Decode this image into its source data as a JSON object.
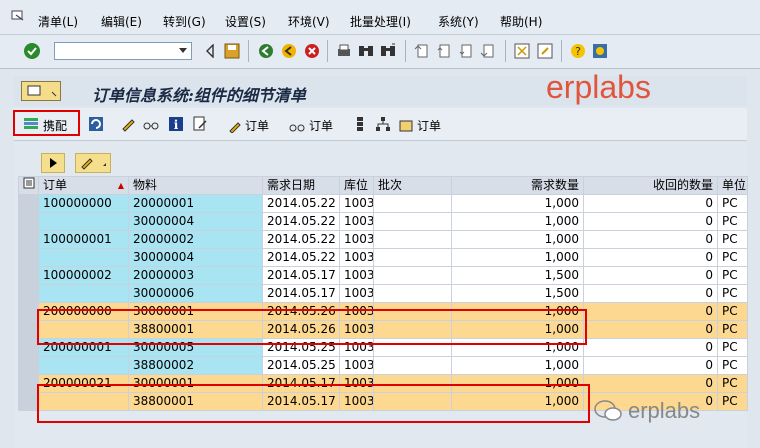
{
  "menu": {
    "items": [
      "清单(L)",
      "编辑(E)",
      "转到(G)",
      "设置(S)",
      "环境(V)",
      "批量处理(I)",
      "系统(Y)",
      "帮助(H)"
    ]
  },
  "command_field": {
    "value": ""
  },
  "title": "订单信息系统:组件的细节清单",
  "watermark": "erplabs",
  "toolbar2": {
    "match_label": "携配",
    "order_label_1": "订单",
    "order_label_2": "订单",
    "order_label_3": "订单"
  },
  "table": {
    "headers": [
      "订单",
      "物料",
      "需求日期",
      "库位",
      "批次",
      "需求数量",
      "收回的数量",
      "单位"
    ],
    "rows": [
      [
        "100000000",
        "20000001",
        "2014.05.22",
        "1003",
        "",
        "1,000",
        "0",
        "PC"
      ],
      [
        "",
        "30000004",
        "2014.05.22",
        "1003",
        "",
        "1,000",
        "0",
        "PC"
      ],
      [
        "100000001",
        "20000002",
        "2014.05.22",
        "1003",
        "",
        "1,000",
        "0",
        "PC"
      ],
      [
        "",
        "30000004",
        "2014.05.22",
        "1003",
        "",
        "1,000",
        "0",
        "PC"
      ],
      [
        "100000002",
        "20000003",
        "2014.05.17",
        "1003",
        "",
        "1,500",
        "0",
        "PC"
      ],
      [
        "",
        "30000006",
        "2014.05.17",
        "1003",
        "",
        "1,500",
        "0",
        "PC"
      ],
      [
        "200000000",
        "30000001",
        "2014.05.26",
        "1003",
        "",
        "1,000",
        "0",
        "PC"
      ],
      [
        "",
        "38800001",
        "2014.05.26",
        "1003",
        "",
        "1,000",
        "0",
        "PC"
      ],
      [
        "200000001",
        "30000005",
        "2014.05.25",
        "1003",
        "",
        "1,000",
        "0",
        "PC"
      ],
      [
        "",
        "38800002",
        "2014.05.25",
        "1003",
        "",
        "1,000",
        "0",
        "PC"
      ],
      [
        "200000021",
        "30000001",
        "2014.05.17",
        "1003",
        "",
        "1,000",
        "0",
        "PC"
      ],
      [
        "",
        "38800001",
        "2014.05.17",
        "1003",
        "",
        "1,000",
        "0",
        "PC"
      ]
    ]
  },
  "colors": {
    "highlight": "#fdd891",
    "key_column": "#a9e4f3",
    "red_box": "#e00000"
  }
}
